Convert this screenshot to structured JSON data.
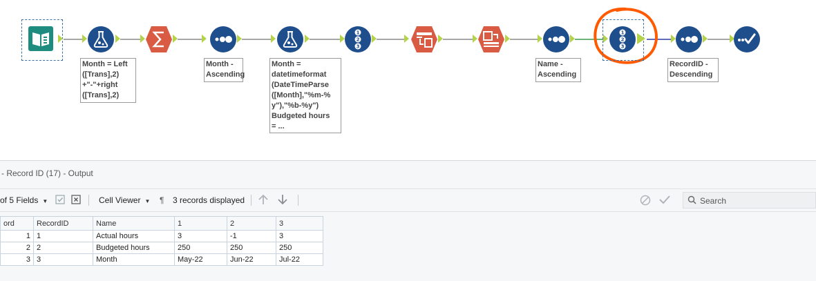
{
  "annotations": {
    "formula1": "Month = Left\n([Trans],2)\n+\"-\"+right\n([Trans],2)",
    "sort1": "Month -\nAscending",
    "formula2": "Month =\ndatetimeformat\n(DateTimeParse\n([Month],\"%m-%\ny\"),\"%b-%y\")\nBudgeted hours\n= ...",
    "sort2": "Name -\nAscending",
    "sort3": "RecordID -\nDescending"
  },
  "colors": {
    "tool_blue": "#1f4e8c",
    "input_teal": "#1e8c7e",
    "summarize_red": "#d95b43",
    "anchor_green": "#b5d34a",
    "highlight_orange": "#ff5a00"
  },
  "results": {
    "title": "- Record ID (17) - Output",
    "toolbar": {
      "fields_label": "of 5 Fields",
      "viewer_label": "Cell Viewer",
      "pilcrow": "¶",
      "records_label": "3 records displayed",
      "search_placeholder": "Search"
    },
    "columns": [
      "ord",
      "RecordID",
      "Name",
      "1",
      "2",
      "3"
    ],
    "rows": [
      {
        "rec": "1",
        "recordid": "1",
        "name": "Actual hours",
        "c1": "3",
        "c2": "-1",
        "c3": "3"
      },
      {
        "rec": "2",
        "recordid": "2",
        "name": "Budgeted hours",
        "c1": "250",
        "c2": "250",
        "c3": "250"
      },
      {
        "rec": "3",
        "recordid": "3",
        "name": "Month",
        "c1": "May-22",
        "c2": "Jun-22",
        "c3": "Jul-22"
      }
    ]
  }
}
